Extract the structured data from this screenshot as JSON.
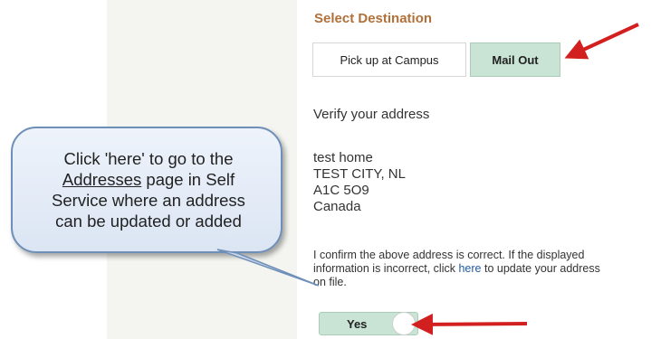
{
  "destination": {
    "title": "Select Destination",
    "options": [
      "Pick up at Campus",
      "Mail Out"
    ],
    "selected": "Mail Out"
  },
  "verify_label": "Verify your address",
  "address": {
    "line1": "test home",
    "line2": "TEST CITY, NL",
    "postal": "A1C 5O9",
    "country": "Canada"
  },
  "confirm": {
    "before": "I confirm the above address is correct. If the displayed information is incorrect, click ",
    "link": "here",
    "after": " to update your address on file."
  },
  "toggle": {
    "label": "Yes",
    "on": true
  },
  "callout": {
    "part1": "Click 'here' to go to the",
    "link_word": "Addresses",
    "part2": " page in Self",
    "part3": "Service where an address",
    "part4": "can be updated or added"
  },
  "colors": {
    "accent": "#b0703a",
    "selected_bg": "#c9e3d4",
    "arrow": "#d21f1f",
    "link": "#1f5ba8"
  }
}
